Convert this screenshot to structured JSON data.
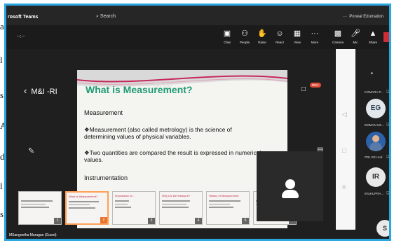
{
  "app": {
    "title": "rosoft Teams",
    "search_placeholder": "Search",
    "user_name": "Porwal Edumation",
    "more_dots": "···"
  },
  "call": {
    "timer": "--:--",
    "toolbar": [
      {
        "label": "Chat",
        "icon": "chat-icon",
        "glyph": "💬"
      },
      {
        "label": "People",
        "icon": "people-icon",
        "glyph": "👥"
      },
      {
        "label": "Raise",
        "icon": "raise-hand-icon",
        "glyph": "✋"
      },
      {
        "label": "React",
        "icon": "react-icon",
        "glyph": "☺"
      },
      {
        "label": "View",
        "icon": "view-icon",
        "glyph": "▦"
      },
      {
        "label": "More",
        "icon": "more-icon",
        "glyph": "···"
      },
      {
        "label": "Camera",
        "icon": "camera-icon",
        "glyph": "▣"
      },
      {
        "label": "Mic",
        "icon": "mic-icon",
        "glyph": "✂"
      },
      {
        "label": "Share",
        "icon": "share-icon",
        "glyph": "▲"
      }
    ]
  },
  "stage": {
    "back_label": "M&I -RI",
    "rec_badge": "REC"
  },
  "slide": {
    "title": "What is Measurement?",
    "timer": "30:00",
    "heading1": "Measurement",
    "para1": "❖Measurement (also called metrology) is the science of determining values of physical variables.",
    "para2": "❖Two quantities are compared the result is expressed in numerical values.",
    "heading2": "Instrumentation"
  },
  "thumbnails": [
    {
      "title": "",
      "num": "1"
    },
    {
      "title": "What is Measurement?",
      "num": "2",
      "active": true
    },
    {
      "title": "Importance of...",
      "num": "3"
    },
    {
      "title": "Why Do We Measure?",
      "num": "4"
    },
    {
      "title": "History of Measurement",
      "num": "5"
    },
    {
      "title": "",
      "num": "6"
    }
  ],
  "participants": [
    {
      "name": "KOMARA P...",
      "initials": ""
    },
    {
      "name": "EMMAN UE...",
      "initials": "EG"
    },
    {
      "name": "PRL EE Hod",
      "initials": ""
    },
    {
      "name": "INUHUPRA...",
      "initials": "IR"
    },
    {
      "name": "",
      "initials": "S"
    }
  ],
  "footer_name": "MSangeetha Murugan (Guest)",
  "colors": {
    "accent": "#29a8e0",
    "slide_title": "#1e9a74",
    "share_red": "#d02d34",
    "active_thumb": "#ff9f55"
  }
}
